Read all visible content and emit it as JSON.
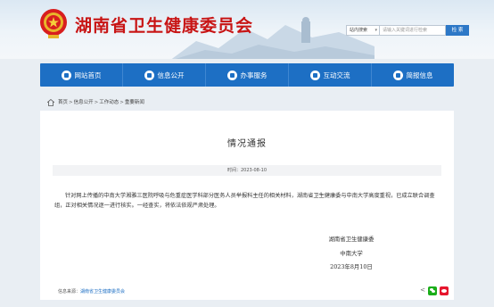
{
  "header": {
    "site_title": "湖南省卫生健康委员会",
    "search": {
      "scope": "站内搜索",
      "placeholder": "请输入关键词进行检索",
      "button": "检 索"
    }
  },
  "nav": {
    "items": [
      {
        "label": "网站首页",
        "icon": "home-icon"
      },
      {
        "label": "信息公开",
        "icon": "document-icon"
      },
      {
        "label": "办事服务",
        "icon": "service-icon"
      },
      {
        "label": "互动交流",
        "icon": "chat-icon"
      },
      {
        "label": "简报信息",
        "icon": "bulletin-icon"
      }
    ]
  },
  "breadcrumb": {
    "items": [
      "首页",
      "信息公开",
      "工作动态",
      "重要新闻"
    ],
    "separator": ">"
  },
  "article": {
    "title": "情况通报",
    "date_label": "时间：",
    "date": "2023-08-10",
    "body": "针对网上传播的中南大学湘雅三医院呼吸与危重症医学科部分医务人员举报科主任的相关材料，湖南省卫生健康委与中南大学高度重视，已成立联合调查组，正对相关情况逐一进行核实。一经查实，将依法依规严肃处理。",
    "signatures": [
      "湖南省卫生健康委",
      "中南大学",
      "2023年8月10日"
    ],
    "source_label": "信息来源：",
    "source": "湖南省卫生健康委员会"
  },
  "colors": {
    "brand_red": "#c81414",
    "nav_blue": "#1d6fc4",
    "page_bg": "#e9eef3"
  }
}
